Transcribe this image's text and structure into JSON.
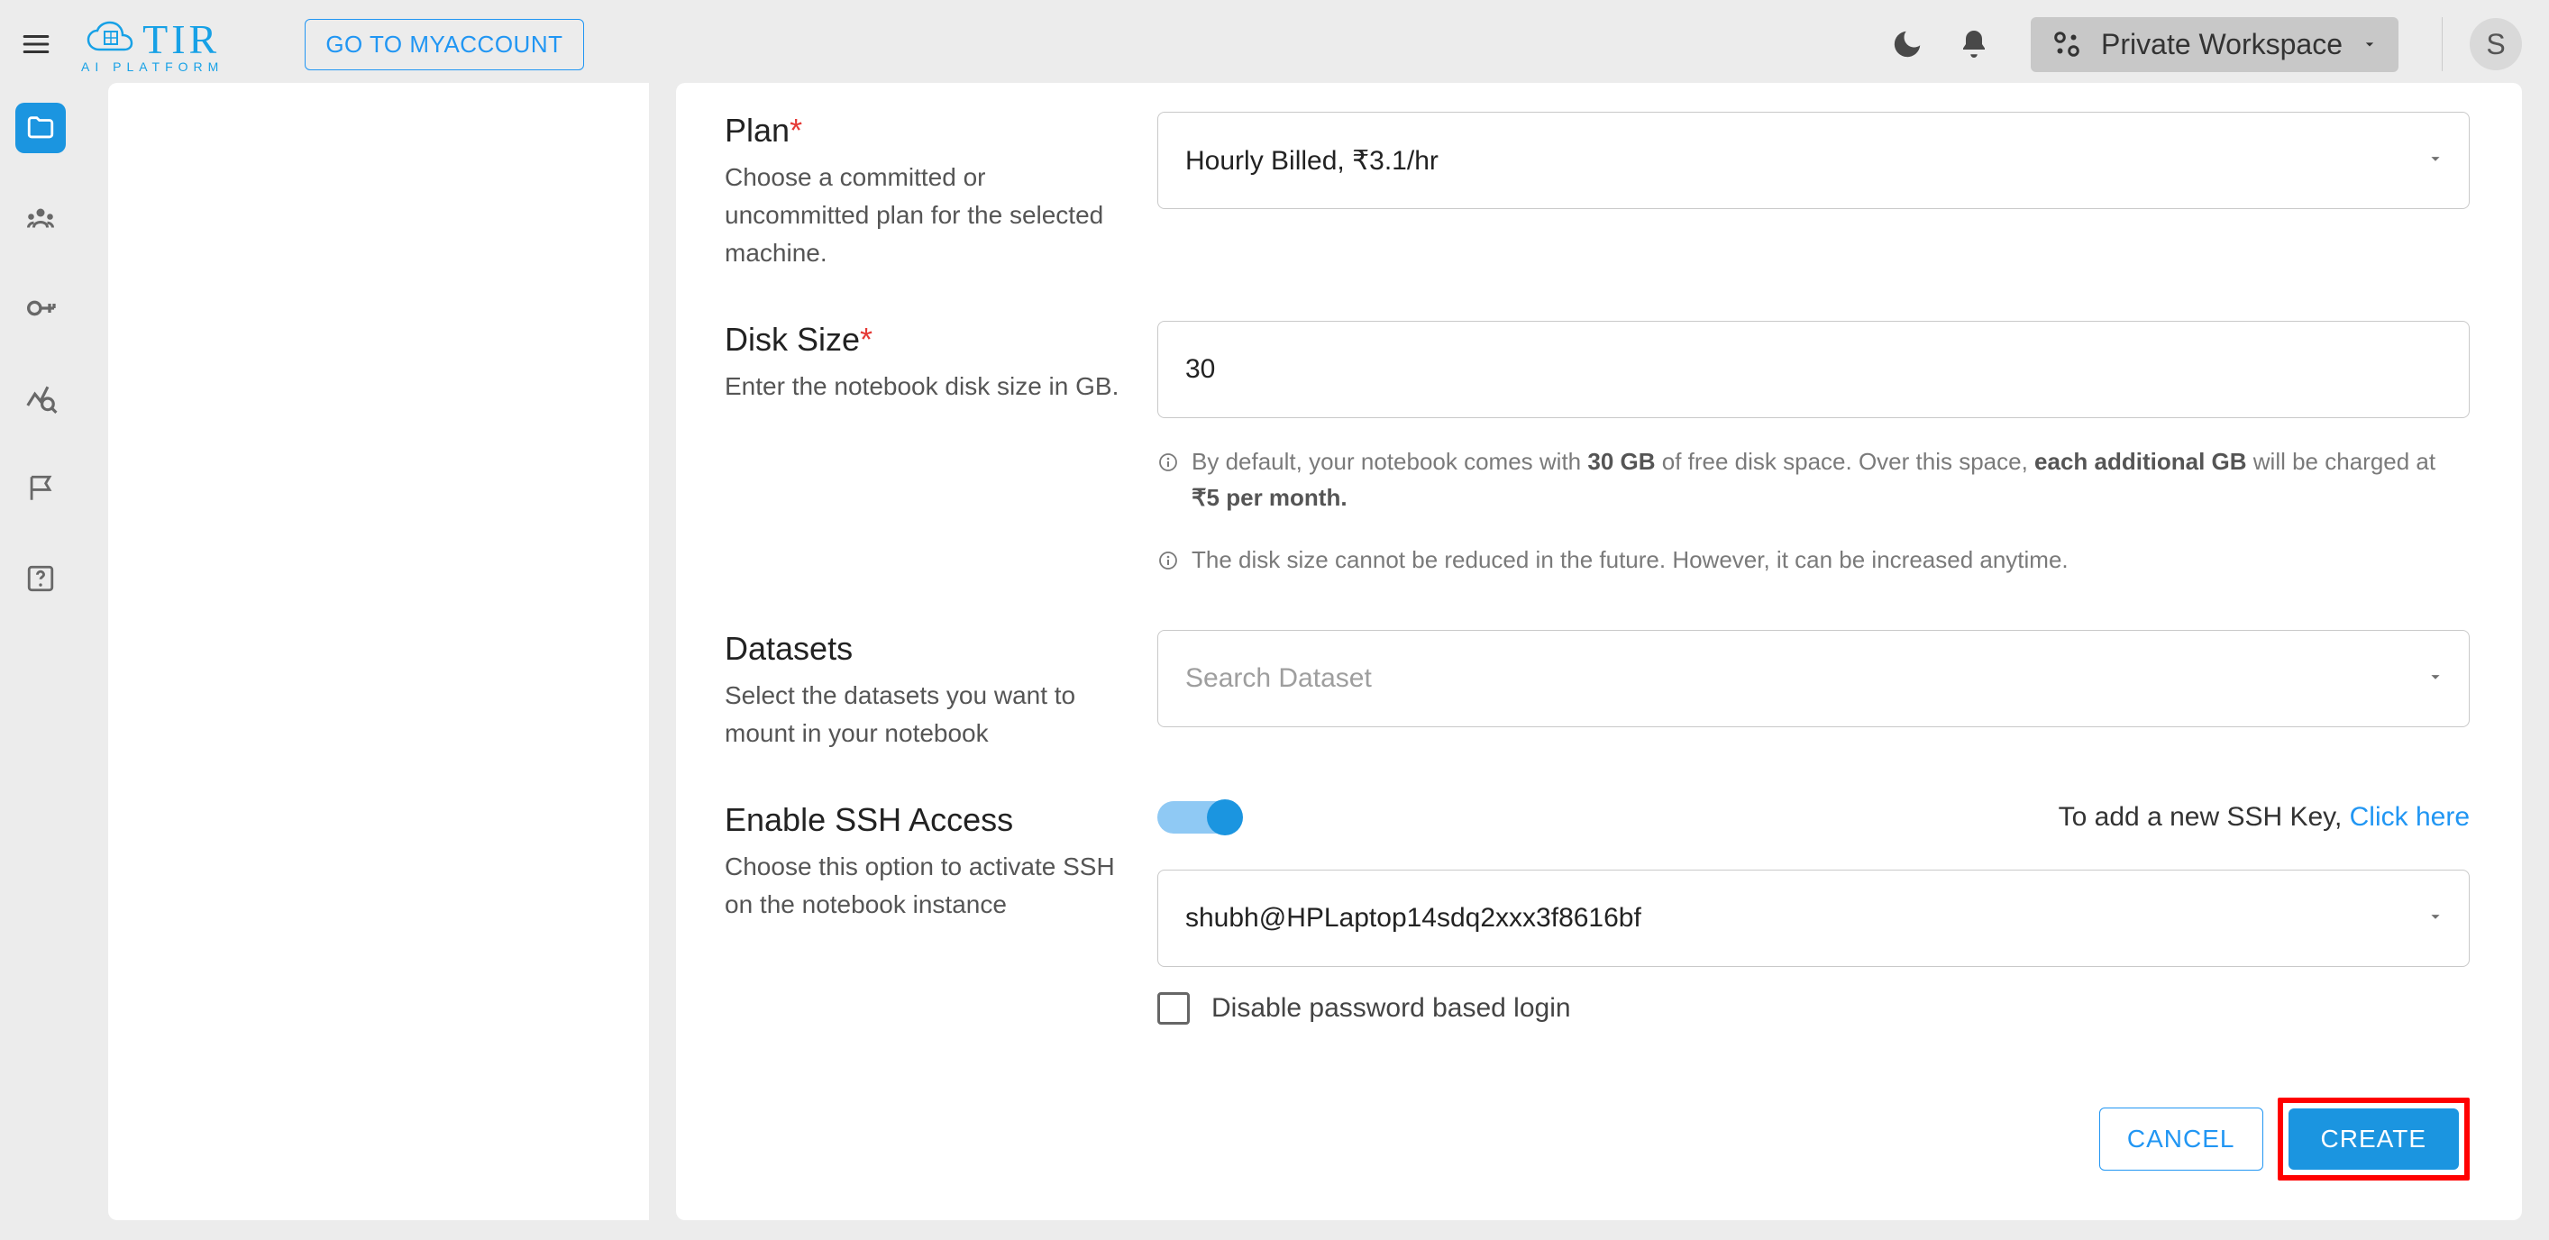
{
  "header": {
    "logo_text": "TIR",
    "logo_sub": "AI PLATFORM",
    "go_my_account": "GO TO MYACCOUNT",
    "workspace_label": "Private Workspace",
    "avatar_initial": "S"
  },
  "form": {
    "plan": {
      "title": "Plan",
      "desc": "Choose a committed or uncommitted plan for the selected machine.",
      "value": "Hourly Billed, ₹3.1/hr"
    },
    "disk": {
      "title": "Disk Size",
      "desc": "Enter the notebook disk size in GB.",
      "value": "30",
      "help1_pre": "By default, your notebook comes with ",
      "help1_b1": "30 GB",
      "help1_mid": " of free disk space. Over this space, ",
      "help1_b2": "each additional GB",
      "help1_post": " will be charged at ",
      "help1_b3": "₹5 per month.",
      "help2": "The disk size cannot be reduced in the future. However, it can be increased anytime."
    },
    "datasets": {
      "title": "Datasets",
      "desc": "Select the datasets you want to mount in your notebook",
      "placeholder": "Search Dataset"
    },
    "ssh": {
      "title": "Enable SSH Access",
      "desc": "Choose this option to activate SSH on the notebook instance",
      "hint_pre": "To add a new SSH Key, ",
      "hint_link": "Click here",
      "key_value": "shubh@HPLaptop14sdq2xxx3f8616bf",
      "disable_pw": "Disable password based login"
    },
    "actions": {
      "cancel": "CANCEL",
      "create": "CREATE"
    }
  }
}
